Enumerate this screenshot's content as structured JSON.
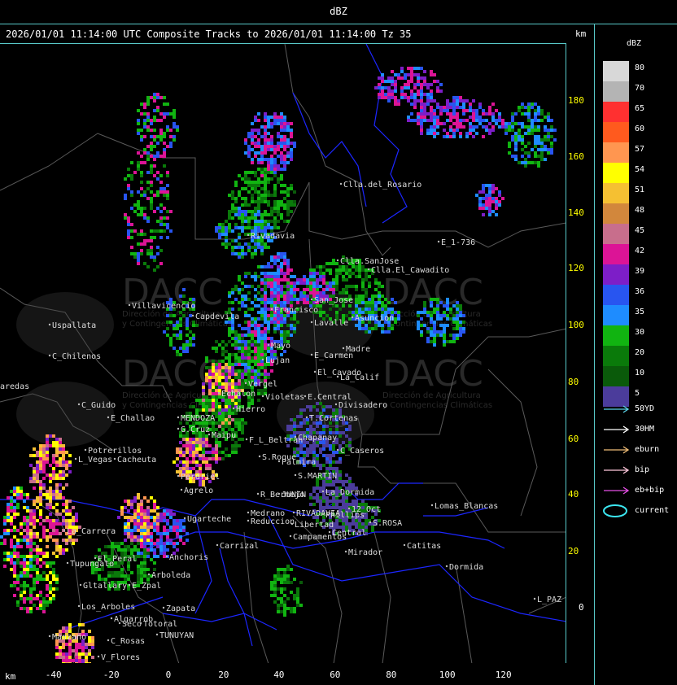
{
  "header": {
    "product": "dBZ",
    "subtitle": "2026/01/01 11:14:00 UTC Composite Tracks to 2026/01/01 11:14:00 Tz 35",
    "km_label": "km"
  },
  "axes": {
    "x_label": "km",
    "x_ticks": [
      "-40",
      "-20",
      "0",
      "20",
      "40",
      "60",
      "80",
      "100",
      "120"
    ],
    "y_ticks": [
      "180",
      "160",
      "140",
      "120",
      "100",
      "80",
      "60",
      "40",
      "20",
      "0"
    ]
  },
  "legend": {
    "title": "dBZ",
    "levels": [
      {
        "label": "80",
        "color": "#d8d8d8"
      },
      {
        "label": "70",
        "color": "#b4b4b4"
      },
      {
        "label": "65",
        "color": "#ff3030"
      },
      {
        "label": "60",
        "color": "#ff5a1e"
      },
      {
        "label": "57",
        "color": "#ff9650"
      },
      {
        "label": "54",
        "color": "#ffff00"
      },
      {
        "label": "51",
        "color": "#f5c032"
      },
      {
        "label": "48",
        "color": "#d2873c"
      },
      {
        "label": "45",
        "color": "#c86e8c"
      },
      {
        "label": "42",
        "color": "#dc1496"
      },
      {
        "label": "39",
        "color": "#7d1ec8"
      },
      {
        "label": "36",
        "color": "#2855f0"
      },
      {
        "label": "35",
        "color": "#1e8cff"
      },
      {
        "label": "30",
        "color": "#11b411"
      },
      {
        "label": "20",
        "color": "#0a7a0a"
      },
      {
        "label": "10",
        "color": "#0a5a0a"
      },
      {
        "label": "5",
        "color": "#4b3c9b"
      }
    ],
    "tracks": [
      {
        "label": "50YD",
        "color": "#5ad2e6"
      },
      {
        "label": "30HM",
        "color": "#ffffff"
      },
      {
        "label": "eburn",
        "color": "#f0be78"
      },
      {
        "label": "bip",
        "color": "#ffc8dc"
      },
      {
        "label": "eb+bip",
        "color": "#e650e6"
      },
      {
        "label": "current",
        "color": "#3ce6f0"
      }
    ]
  },
  "watermark": {
    "brand": "DACC",
    "tagline_1": "Dirección de Agricultura",
    "tagline_2": "y Contingencias Climáticas"
  },
  "places": [
    "Clla.del_Rosario",
    "Rivadavia",
    "Clla.SanJose",
    "Clla.El_Cawadito",
    "E_1-736",
    "Villavicencio",
    "Uspallata",
    "C_Chilenos",
    "aredas",
    "Capdevila",
    "Francisco",
    "San_Jose",
    "Lavalle",
    "Asuncion",
    "Mayo",
    "Lujan",
    "E_Carmen",
    "Madre",
    "El_Cavado",
    "La_Calif",
    "Vergel",
    "Echalon",
    "Violetas",
    "E.Central",
    "Divisadero",
    "C_Guido",
    "E_Challao",
    "MENDOZA",
    "Hierro",
    "T.Cortenas",
    "G.Cruz",
    "Maipu",
    "F_L_Beltran",
    "Chapanay",
    "C_Caseros",
    "Potrerillos",
    "L_Vegas",
    "Cacheuta",
    "S.Roque",
    "Palmira",
    "S.MARTIN",
    "Perdriel",
    "Ugarteche",
    "Agrelo",
    "R_Bermejo",
    "JUNIN",
    "La_Dormida",
    "RIVADAVIA",
    "Phillips",
    "Medrano",
    "Reduccion",
    "12_Oct",
    "S.ROSA",
    "Lomas_Blancas",
    "La_Carrera",
    "Carrizal",
    "Libertad",
    "Campamentos",
    "Central",
    "Catitas",
    "Tupungato",
    "Anchoris",
    "Mirador",
    "Dormida",
    "El_Peral",
    "Arboleda",
    "Gltallary",
    "E_Zpal",
    "Los_Arboles",
    "Zapata",
    "Algarrob",
    "Seco",
    "Totoral",
    "TUNUYAN",
    "Manzano",
    "C_Rosas",
    "V_Flores",
    "L_PAZ"
  ]
}
